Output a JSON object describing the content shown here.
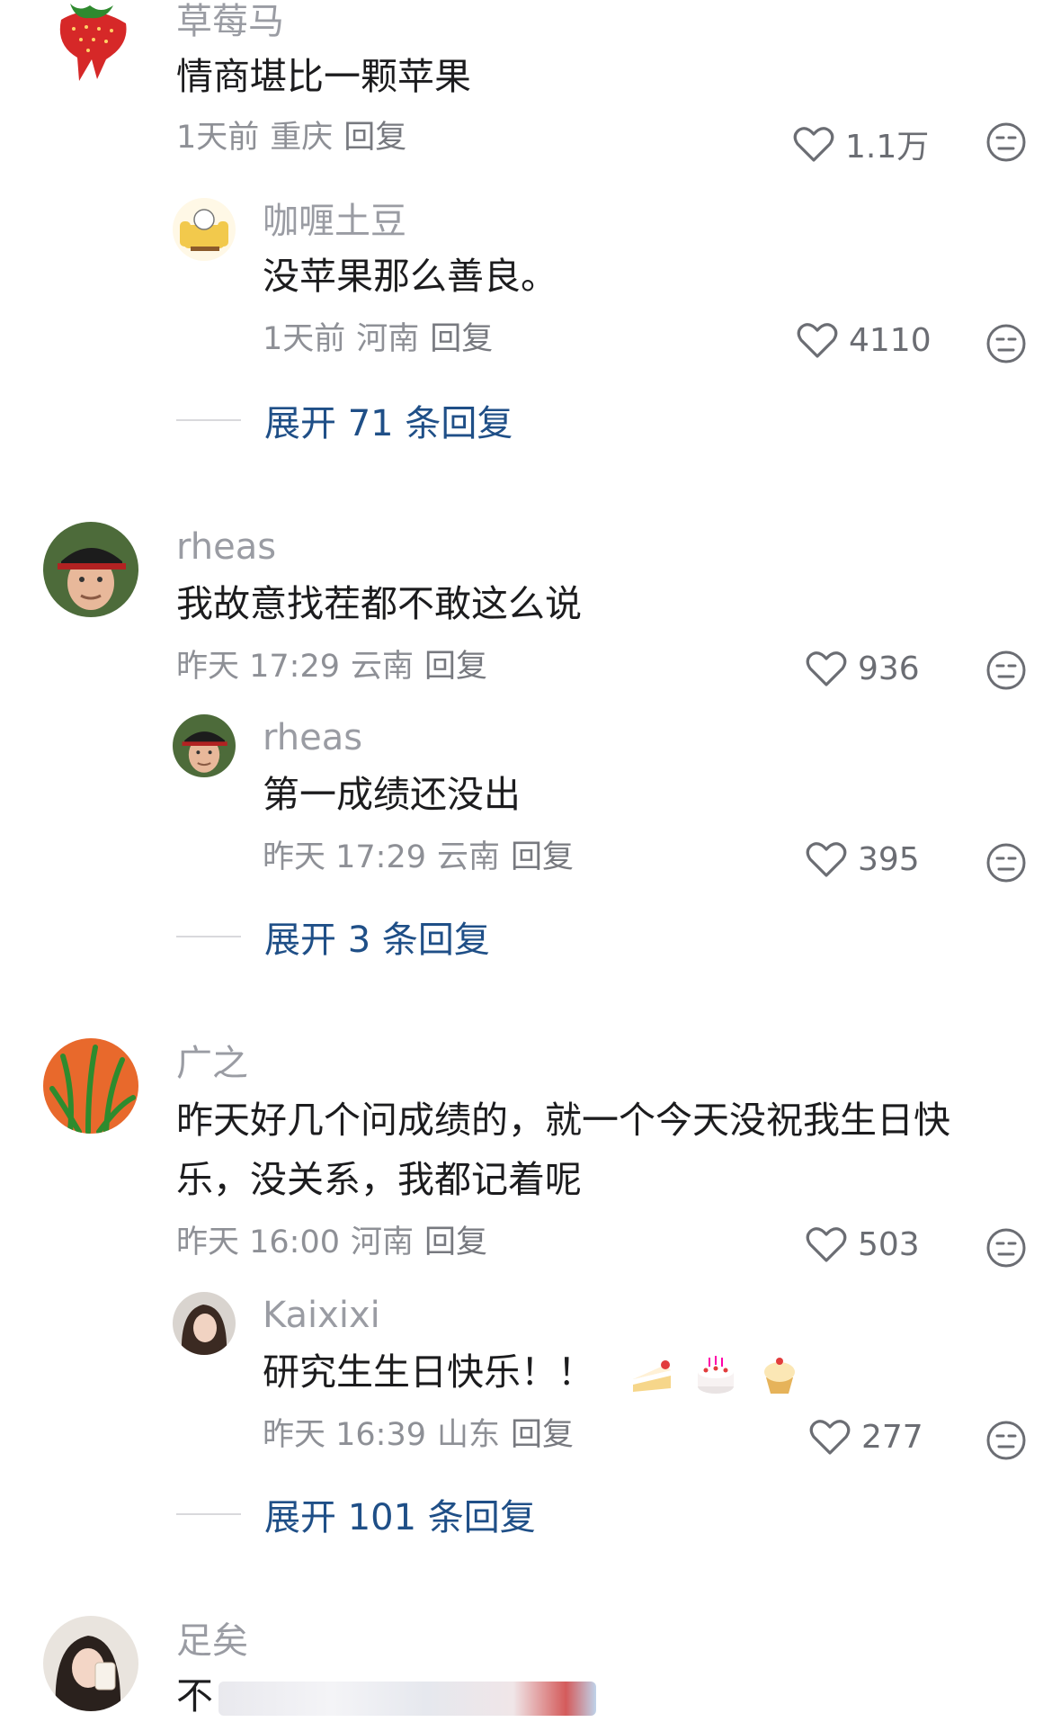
{
  "comments": [
    {
      "username": "草莓马",
      "text": "情商堪比一颗苹果",
      "time": "1天前",
      "location": "重庆",
      "reply_label": "回复",
      "likes": "1.1万",
      "replies": [
        {
          "username": "咖喱土豆",
          "text": "没苹果那么善良。",
          "time": "1天前",
          "location": "河南",
          "reply_label": "回复",
          "likes": "4110"
        }
      ],
      "expand_label": "展开 71 条回复"
    },
    {
      "username": "rheas",
      "text": "我故意找茬都不敢这么说",
      "time": "昨天 17:29",
      "location": "云南",
      "reply_label": "回复",
      "likes": "936",
      "replies": [
        {
          "username": "rheas",
          "text": "第一成绩还没出",
          "time": "昨天 17:29",
          "location": "云南",
          "reply_label": "回复",
          "likes": "395"
        }
      ],
      "expand_label": "展开 3 条回复"
    },
    {
      "username": "广之",
      "text_line1": "昨天好几个问成绩的，就一个今天没祝我生日快",
      "text_line2": "乐，没关系，我都记着呢",
      "time": "昨天 16:00",
      "location": "河南",
      "reply_label": "回复",
      "likes": "503",
      "replies": [
        {
          "username": "Kaixixi",
          "text": "研究生生日快乐！！",
          "emojis": [
            "cake-slice",
            "birthday-cake",
            "cupcake"
          ],
          "time": "昨天 16:39",
          "location": "山东",
          "reply_label": "回复",
          "likes": "277"
        }
      ],
      "expand_label": "展开 101 条回复"
    },
    {
      "username": "足矣",
      "text_visible_start": "不"
    }
  ],
  "icons": {
    "like": "heart-outline-icon",
    "dislike": "unamused-face-icon"
  },
  "colors": {
    "expand_link": "#1f4f87",
    "meta_text": "#8e9096",
    "username": "#9a9ca3"
  }
}
